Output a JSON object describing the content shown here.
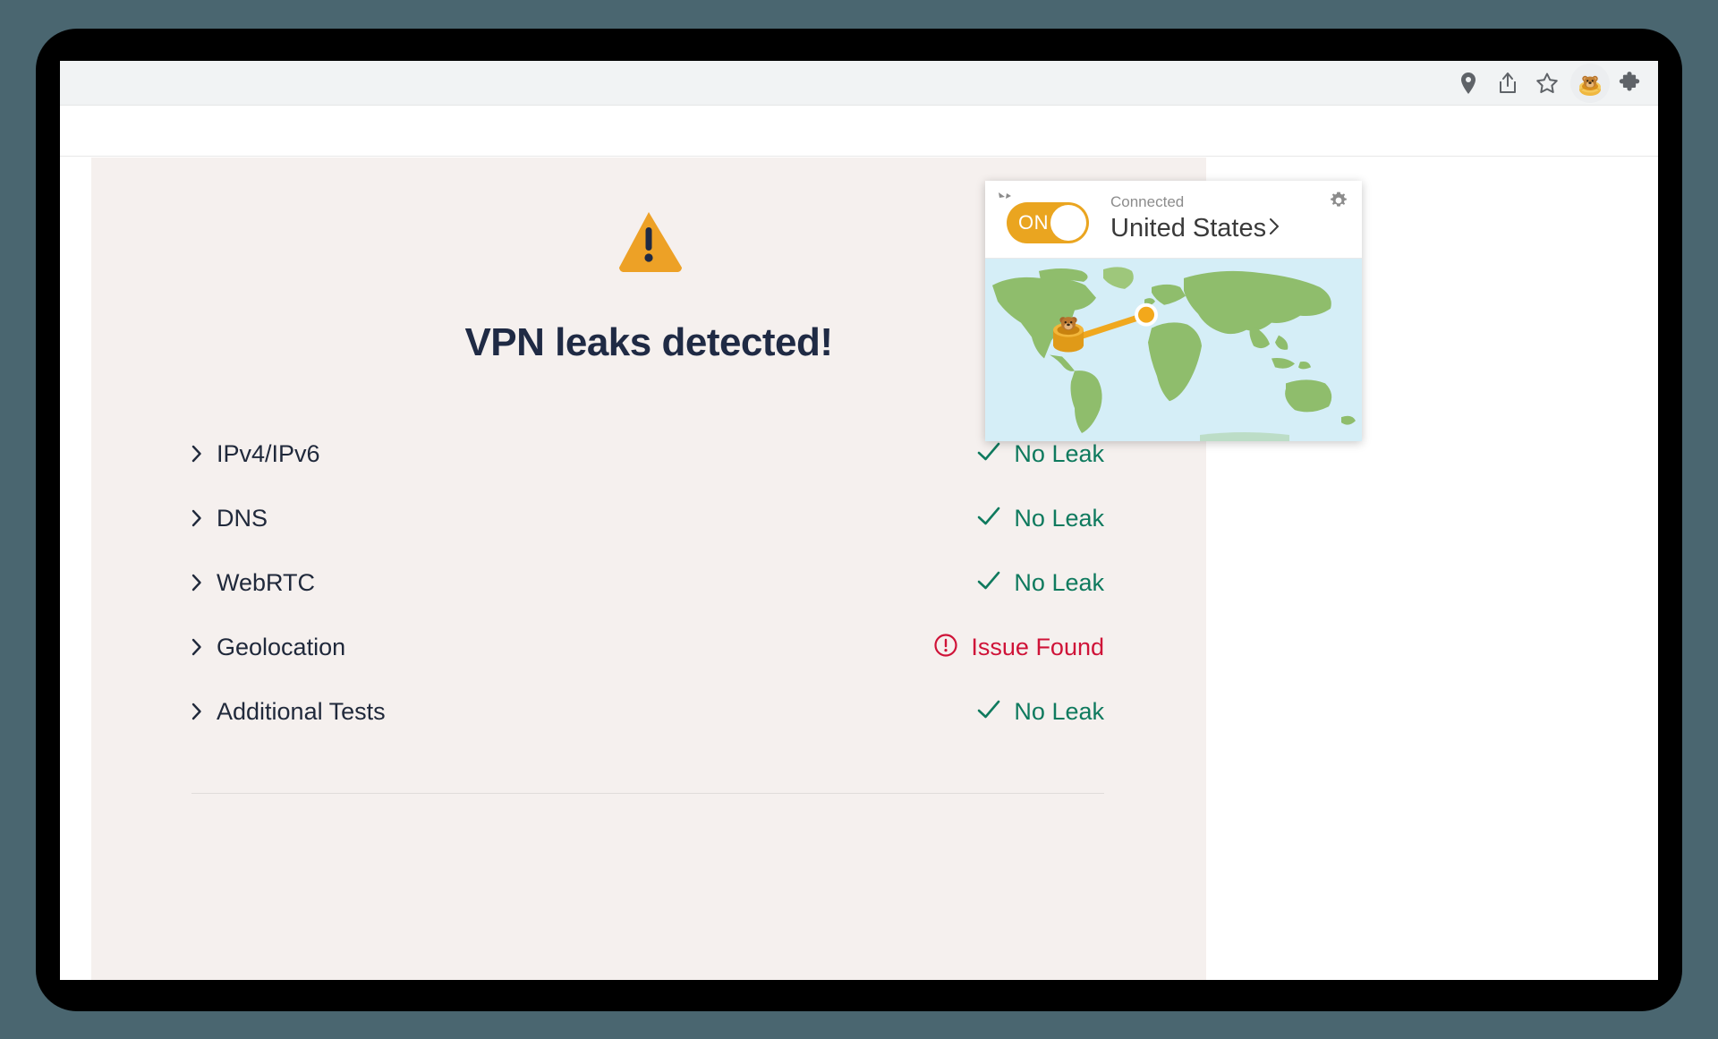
{
  "window": {
    "background_color": "#4a6670",
    "frame_color": "#000000"
  },
  "browser": {
    "toolbar": {
      "icons": [
        {
          "name": "location-pin-icon",
          "label": "Site information"
        },
        {
          "name": "share-icon",
          "label": "Share"
        },
        {
          "name": "bookmark-star-icon",
          "label": "Bookmark this tab"
        },
        {
          "name": "tunnelbear-extension-icon",
          "label": "TunnelBear VPN"
        },
        {
          "name": "extensions-puzzle-icon",
          "label": "Extensions"
        }
      ]
    }
  },
  "page": {
    "warning_icon": "warning-triangle-icon",
    "title": "VPN leaks detected!",
    "background_color": "#f5f0ee",
    "title_color": "#1f2a44",
    "ok_color": "#0f7a5e",
    "issue_color": "#cf1338",
    "tests": [
      {
        "label": "IPv4/IPv6",
        "status": "No Leak",
        "state": "ok",
        "icon": "check-icon"
      },
      {
        "label": "DNS",
        "status": "No Leak",
        "state": "ok",
        "icon": "check-icon"
      },
      {
        "label": "WebRTC",
        "status": "No Leak",
        "state": "ok",
        "icon": "check-icon"
      },
      {
        "label": "Geolocation",
        "status": "Issue Found",
        "state": "issue",
        "icon": "alert-circle-icon"
      },
      {
        "label": "Additional Tests",
        "status": "No Leak",
        "state": "ok",
        "icon": "check-icon"
      }
    ]
  },
  "vpn_popup": {
    "collapse_icon": "collapse-arrows-icon",
    "settings_icon": "gear-icon",
    "toggle": {
      "label": "ON",
      "state": "on",
      "color": "#eaa520"
    },
    "connection": {
      "status": "Connected",
      "country": "United States",
      "chevron": "chevron-right-icon"
    },
    "map": {
      "ocean_color": "#d5eef7",
      "land_color": "#8cbb6a",
      "tunnel_color": "#eaa520",
      "origin_marker": "bear-in-tunnel-icon",
      "destination_marker": "connection-endpoint-dot"
    }
  }
}
